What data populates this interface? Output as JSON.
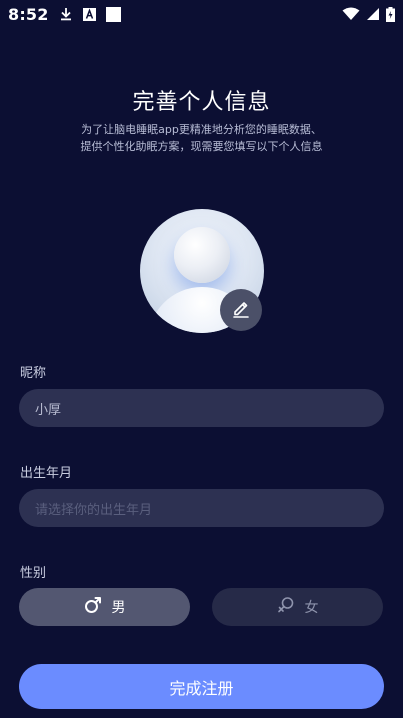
{
  "status_bar": {
    "time": "8:52",
    "icons": [
      "download-icon",
      "text-a-icon",
      "square-notification-icon",
      "wifi-icon",
      "signal-icon",
      "battery-charging-icon"
    ]
  },
  "header": {
    "title": "完善个人信息",
    "description": "为了让脑电睡眠app更精准地分析您的睡眠数据、\n提供个性化助眠方案，现需要您填写以下个人信息"
  },
  "avatar": {
    "icon": "default-avatar",
    "edit_icon": "edit-pen-icon"
  },
  "form": {
    "nickname": {
      "label": "昵称",
      "value": "小厚"
    },
    "birth": {
      "label": "出生年月",
      "placeholder": "请选择你的出生年月"
    },
    "gender": {
      "label": "性别",
      "options": [
        {
          "label": "男",
          "icon": "male-icon",
          "selected": true
        },
        {
          "label": "女",
          "icon": "female-icon",
          "selected": false
        }
      ]
    }
  },
  "submit_label": "完成注册",
  "colors": {
    "background": "#0c0f33",
    "field": "#2d3152",
    "accent": "#6b8cff",
    "selected": "#535771",
    "unselected": "#262a48"
  }
}
